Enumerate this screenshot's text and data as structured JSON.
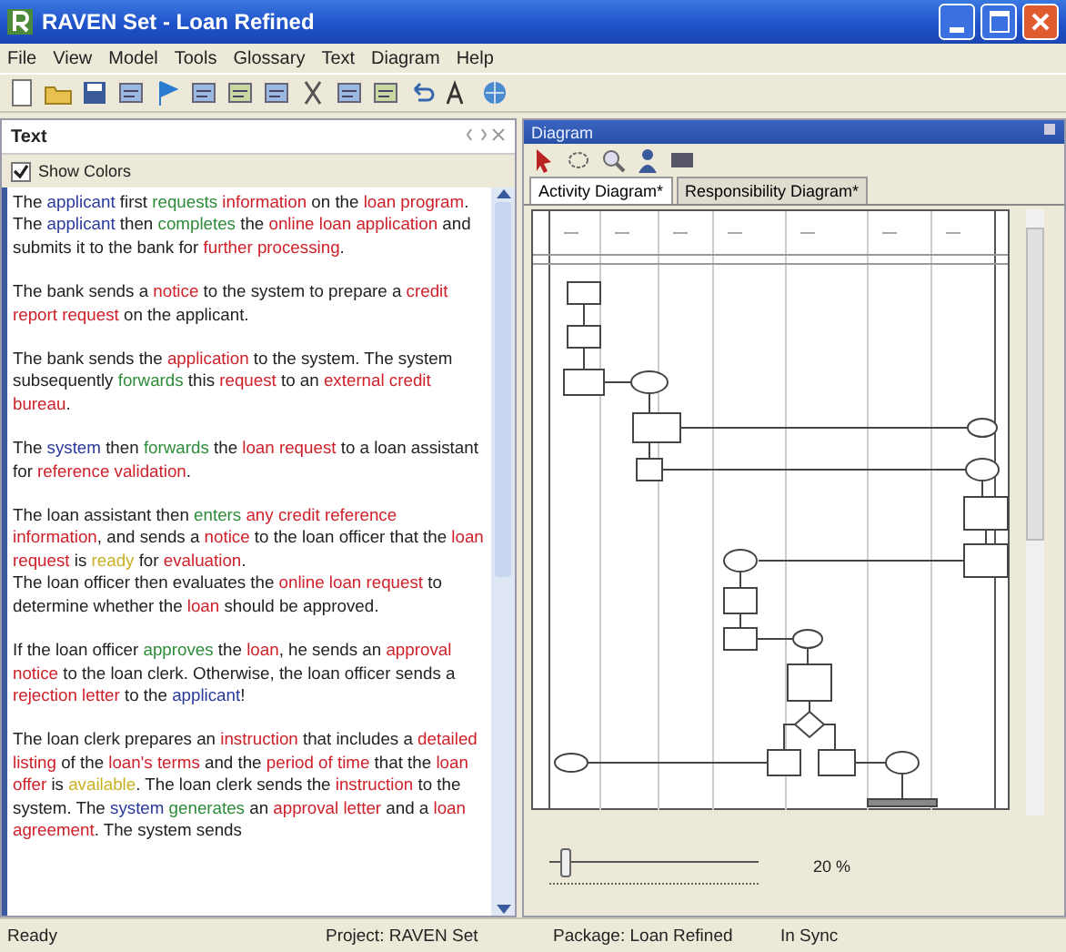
{
  "window": {
    "title": "RAVEN Set - Loan Refined"
  },
  "menu": [
    "File",
    "View",
    "Model",
    "Tools",
    "Glossary",
    "Text",
    "Diagram",
    "Help"
  ],
  "text_panel": {
    "title": "Text",
    "show_colors": {
      "label": "Show Colors",
      "checked": true
    },
    "paragraphs": [
      {
        "segments": [
          {
            "t": "The "
          },
          {
            "t": "applicant",
            "color": "#2a3a9a"
          },
          {
            "t": " first "
          },
          {
            "t": "requests ",
            "color": "#2e8b3a"
          },
          {
            "t": "information",
            "color": "#d0202a"
          },
          {
            "t": " on the "
          },
          {
            "t": "loan program",
            "color": "#d0202a"
          },
          {
            "t": ". The "
          },
          {
            "t": "applicant",
            "color": "#2a3a9a"
          },
          {
            "t": " then "
          },
          {
            "t": "completes",
            "color": "#2e8b3a"
          },
          {
            "t": " the "
          },
          {
            "t": "online loan application",
            "color": "#d0202a"
          },
          {
            "t": " and submits it to the bank for "
          },
          {
            "t": "further processing",
            "color": "#d0202a"
          },
          {
            "t": "."
          }
        ]
      },
      {
        "segments": [
          {
            "t": "The bank sends a "
          },
          {
            "t": "notice",
            "color": "#d0202a"
          },
          {
            "t": " to the system to prepare a "
          },
          {
            "t": "credit report request",
            "color": "#d0202a"
          },
          {
            "t": " on the applicant."
          }
        ]
      },
      {
        "segments": [
          {
            "t": "The bank sends the "
          },
          {
            "t": "application",
            "color": "#d0202a"
          },
          {
            "t": " to the system. The system subsequently "
          },
          {
            "t": "forwards",
            "color": "#2e8b3a"
          },
          {
            "t": " this "
          },
          {
            "t": "request",
            "color": "#d0202a"
          },
          {
            "t": " to an "
          },
          {
            "t": "external credit bureau",
            "color": "#d0202a"
          },
          {
            "t": "."
          }
        ]
      },
      {
        "segments": [
          {
            "t": "The "
          },
          {
            "t": "system",
            "color": "#2a3a9a"
          },
          {
            "t": " then "
          },
          {
            "t": "forwards",
            "color": "#2e8b3a"
          },
          {
            "t": " the "
          },
          {
            "t": "loan request",
            "color": "#d0202a"
          },
          {
            "t": " to a loan assistant for "
          },
          {
            "t": "reference validation",
            "color": "#d0202a"
          },
          {
            "t": "."
          }
        ]
      },
      {
        "segments": [
          {
            "t": "The loan assistant then "
          },
          {
            "t": "enters ",
            "color": "#2e8b3a"
          },
          {
            "t": "any credit reference information",
            "color": "#d0202a"
          },
          {
            "t": ", and sends a "
          },
          {
            "t": "notice",
            "color": "#d0202a"
          },
          {
            "t": " to the loan officer that the "
          },
          {
            "t": "loan request",
            "color": "#d0202a"
          },
          {
            "t": " is "
          },
          {
            "t": "ready",
            "color": "#c8b020"
          },
          {
            "t": " for "
          },
          {
            "t": "evaluation",
            "color": "#d0202a"
          },
          {
            "t": ".\nThe loan officer then evaluates the "
          },
          {
            "t": "online loan request",
            "color": "#d0202a"
          },
          {
            "t": " to determine whether the "
          },
          {
            "t": "loan",
            "color": "#d0202a"
          },
          {
            "t": " should be approved."
          }
        ]
      },
      {
        "segments": [
          {
            "t": "If the loan officer "
          },
          {
            "t": "approves",
            "color": "#2e8b3a"
          },
          {
            "t": " the "
          },
          {
            "t": "loan",
            "color": "#d0202a"
          },
          {
            "t": ", he sends an "
          },
          {
            "t": "approval notice",
            "color": "#d0202a"
          },
          {
            "t": " to the loan clerk. Otherwise, the loan officer sends a "
          },
          {
            "t": "rejection letter",
            "color": "#d0202a"
          },
          {
            "t": " to the "
          },
          {
            "t": "applicant",
            "color": "#2a3a9a"
          },
          {
            "t": "!"
          }
        ]
      },
      {
        "segments": [
          {
            "t": "The loan clerk prepares an "
          },
          {
            "t": "instruction",
            "color": "#d0202a"
          },
          {
            "t": " that includes a "
          },
          {
            "t": "detailed listing",
            "color": "#d0202a"
          },
          {
            "t": " of the "
          },
          {
            "t": "loan's terms",
            "color": "#d0202a"
          },
          {
            "t": " and the "
          },
          {
            "t": "period of time",
            "color": "#d0202a"
          },
          {
            "t": " that the "
          },
          {
            "t": "loan offer",
            "color": "#d0202a"
          },
          {
            "t": " is "
          },
          {
            "t": "available",
            "color": "#c8b020"
          },
          {
            "t": ". The loan clerk sends the "
          },
          {
            "t": "instruction",
            "color": "#d0202a"
          },
          {
            "t": " to the system. The "
          },
          {
            "t": "system ",
            "color": "#2a3a9a"
          },
          {
            "t": "generates",
            "color": "#2e8b3a"
          },
          {
            "t": " an "
          },
          {
            "t": "approval letter",
            "color": "#d0202a"
          },
          {
            "t": " and a "
          },
          {
            "t": "loan agreement",
            "color": "#d0202a"
          },
          {
            "t": ". The system sends"
          }
        ]
      }
    ]
  },
  "diagram_panel": {
    "title": "Diagram",
    "tabs": [
      {
        "label": "Activity Diagram*",
        "selected": true
      },
      {
        "label": "Responsibility Diagram*",
        "selected": false
      }
    ],
    "zoom": {
      "level": 0.05,
      "reading": "20 %"
    }
  },
  "status_bar": [
    "Ready",
    "Project: RAVEN Set",
    "Package: Loan Refined",
    "In Sync"
  ]
}
